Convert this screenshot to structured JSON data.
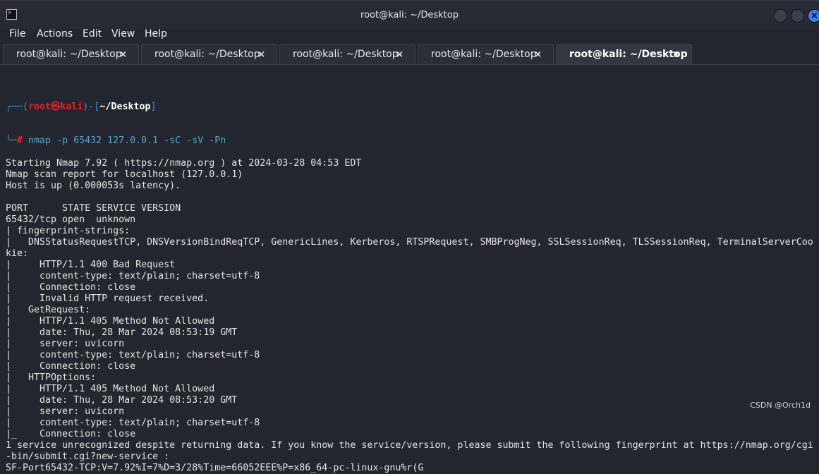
{
  "window": {
    "title": "root@kali: ~/Desktop",
    "icon": "terminal-icon"
  },
  "menu": [
    "File",
    "Actions",
    "Edit",
    "View",
    "Help"
  ],
  "tabs": [
    {
      "label": "root@kali: ~/Desktop",
      "active": false
    },
    {
      "label": "root@kali: ~/Desktop",
      "active": false
    },
    {
      "label": "root@kali: ~/Desktop",
      "active": false
    },
    {
      "label": "root@kali: ~/Desktop",
      "active": false
    },
    {
      "label": "root@kali: ~/Desktop",
      "active": true
    }
  ],
  "tab_close": "×",
  "prompt": {
    "corner1": "┌──(",
    "user": "root",
    "at": "㉿",
    "host": "kali",
    "mid": ")-[",
    "dir": "~/Desktop",
    "end": "]",
    "corner2": "└─",
    "hash": "#",
    "command": " nmap -p 65432 127.0.0.1 -sC -sV -Pn"
  },
  "lines": [
    "Starting Nmap 7.92 ( https://nmap.org ) at 2024-03-28 04:53 EDT",
    "Nmap scan report for localhost (127.0.0.1)",
    "Host is up (0.000053s latency).",
    "",
    "PORT      STATE SERVICE VERSION",
    "65432/tcp open  unknown",
    "| fingerprint-strings:",
    "|   DNSStatusRequestTCP, DNSVersionBindReqTCP, GenericLines, Kerberos, RTSPRequest, SMBProgNeg, SSLSessionReq, TLSSessionReq, TerminalServerCoo",
    "kie:",
    "|     HTTP/1.1 400 Bad Request",
    "|     content-type: text/plain; charset=utf-8",
    "|     Connection: close",
    "|     Invalid HTTP request received.",
    "|   GetRequest:",
    "|     HTTP/1.1 405 Method Not Allowed",
    "|     date: Thu, 28 Mar 2024 08:53:19 GMT",
    "|     server: uvicorn",
    "|     content-type: text/plain; charset=utf-8",
    "|     Connection: close",
    "|   HTTPOptions:",
    "|     HTTP/1.1 405 Method Not Allowed",
    "|     date: Thu, 28 Mar 2024 08:53:20 GMT",
    "|     server: uvicorn",
    "|     content-type: text/plain; charset=utf-8",
    "|_    Connection: close",
    "1 service unrecognized despite returning data. If you know the service/version, please submit the following fingerprint at https://nmap.org/cgi",
    "-bin/submit.cgi?new-service :",
    "SF-Port65432-TCP:V=7.92%I=7%D=3/28%Time=66052EEE%P=x86_64-pc-linux-gnu%r(G"
  ],
  "watermark": "CSDN @Orch1d"
}
